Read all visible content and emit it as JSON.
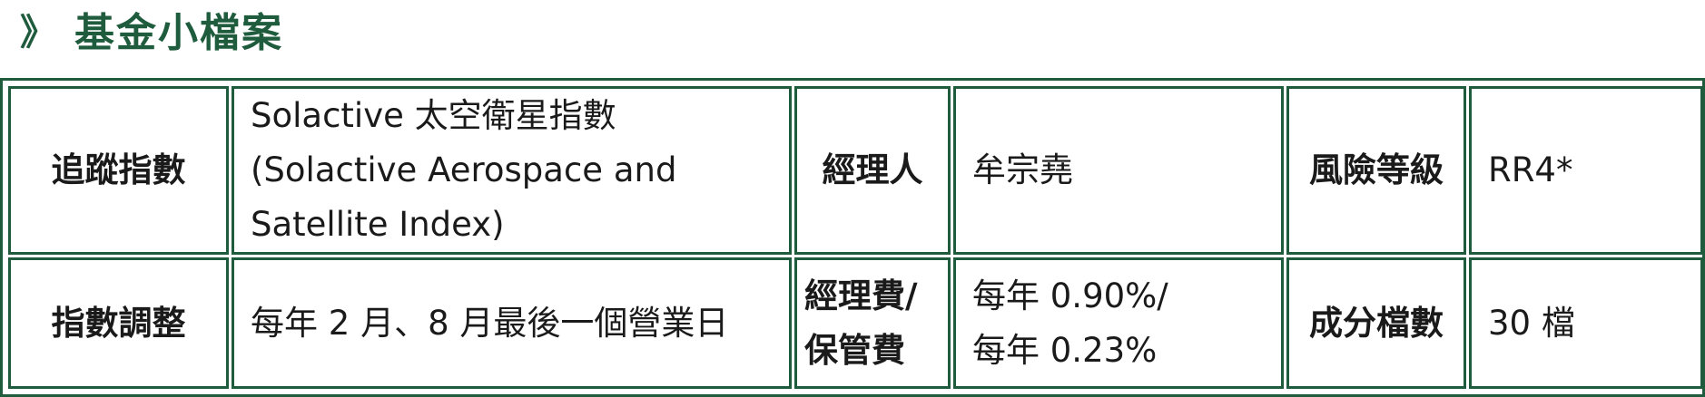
{
  "header": {
    "prefix": "》",
    "title": "基金小檔案"
  },
  "table": {
    "row1": {
      "tracking_index_label": "追蹤指數",
      "tracking_index_value": [
        "Solactive 太空衛星指數",
        "(Solactive Aerospace and",
        "Satellite Index)"
      ],
      "manager_label": "經理人",
      "manager_value": "牟宗堯",
      "risk_label": "風險等級",
      "risk_value": "RR4*"
    },
    "row2": {
      "adjustment_label": "指數調整",
      "adjustment_value": "每年 2 月、8 月最後一個營業日",
      "fee_label": [
        "經理費/",
        "保管費"
      ],
      "fee_value": [
        "每年 0.90%/",
        "每年 0.23%"
      ],
      "holdings_label": "成分檔數",
      "holdings_value": "30 檔"
    }
  },
  "colors": {
    "brand_green": "#1f5c3d",
    "text": "#1a1a1a"
  }
}
